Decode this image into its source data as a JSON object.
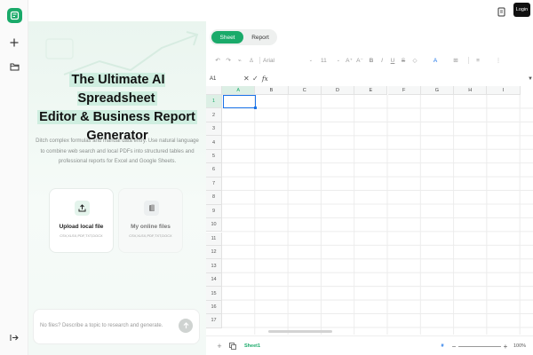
{
  "app": {
    "login_label": "Login",
    "brand_color": "#1aaa6a",
    "icons": [
      "app-logo-icon",
      "plus-icon",
      "folder-icon",
      "collapse-icon",
      "document-icon"
    ]
  },
  "hero": {
    "title_line1": "The Ultimate AI Spreadsheet",
    "title_line2": "Editor & Business Report",
    "title_line3": "Generator",
    "description": "Ditch complex formulas and manual data entry. Use natural language to combine web search and local PDFs into structured tables and professional reports for Excel and Google Sheets.",
    "upload": {
      "title": "Upload local file",
      "formats": "CSV,XLSX,PDF,TXT,DOCX"
    },
    "online": {
      "title": "My online files",
      "formats": "CSV,XLSX,PDF,TXT,DOCX"
    },
    "prompt_placeholder": "No files? Describe a topic to research and generate."
  },
  "sheet": {
    "tabs": {
      "sheet": "Sheet",
      "report": "Report"
    },
    "toolbar": {
      "font": "Arial",
      "size": "11"
    },
    "formula": {
      "cell_ref": "A1",
      "fx": "fx"
    },
    "columns": [
      "A",
      "B",
      "C",
      "D",
      "E",
      "F",
      "G",
      "H",
      "I"
    ],
    "rows": [
      "1",
      "2",
      "3",
      "4",
      "5",
      "6",
      "7",
      "8",
      "9",
      "10",
      "11",
      "12",
      "13",
      "14",
      "15",
      "16",
      "17"
    ],
    "selected_cell": "A1",
    "sheet_name": "Sheet1",
    "zoom": "100%"
  }
}
